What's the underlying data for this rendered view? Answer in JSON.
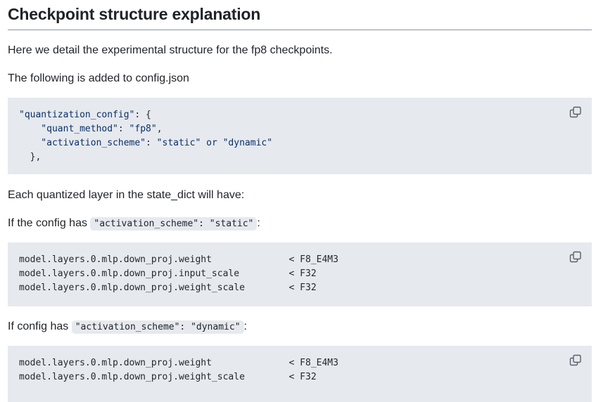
{
  "title": "Checkpoint structure explanation",
  "intro": "Here we detail the experimental structure for the fp8 checkpoints.",
  "config_note": "The following is added to config.json",
  "config_block": {
    "lines": [
      [
        {
          "t": "\"quantization_config\"",
          "c": "key"
        },
        {
          "t": ": {",
          "c": "pun"
        }
      ],
      [
        {
          "t": "    \"quant_method\"",
          "c": "key"
        },
        {
          "t": ": ",
          "c": "pun"
        },
        {
          "t": "\"fp8\"",
          "c": "key"
        },
        {
          "t": ",",
          "c": "pun"
        }
      ],
      [
        {
          "t": "    \"activation_scheme\"",
          "c": "key"
        },
        {
          "t": ": ",
          "c": "pun"
        },
        {
          "t": "\"static\"",
          "c": "key"
        },
        {
          "t": " or ",
          "c": "key"
        },
        {
          "t": "\"dynamic\"",
          "c": "key"
        }
      ],
      [
        {
          "t": "  },",
          "c": "pun"
        }
      ]
    ]
  },
  "layer_note": "Each quantized layer in the state_dict will have:",
  "static_note": {
    "prefix": "If the config has ",
    "code": "\"activation_scheme\": \"static\"",
    "suffix": ":"
  },
  "static_block": {
    "lines": [
      "model.layers.0.mlp.down_proj.weight              < F8_E4M3",
      "model.layers.0.mlp.down_proj.input_scale         < F32",
      "model.layers.0.mlp.down_proj.weight_scale        < F32"
    ]
  },
  "dynamic_note": {
    "prefix": "If config has ",
    "code": "\"activation_scheme\": \"dynamic\"",
    "suffix": ":"
  },
  "dynamic_block": {
    "lines": [
      "model.layers.0.mlp.down_proj.weight              < F8_E4M3",
      "model.layers.0.mlp.down_proj.weight_scale        < F32"
    ]
  },
  "icons": {
    "copy": "copy-icon"
  },
  "colors": {
    "code_bg": "#e6e9ee",
    "code_key": "#0a3069",
    "text": "#1f2328"
  }
}
